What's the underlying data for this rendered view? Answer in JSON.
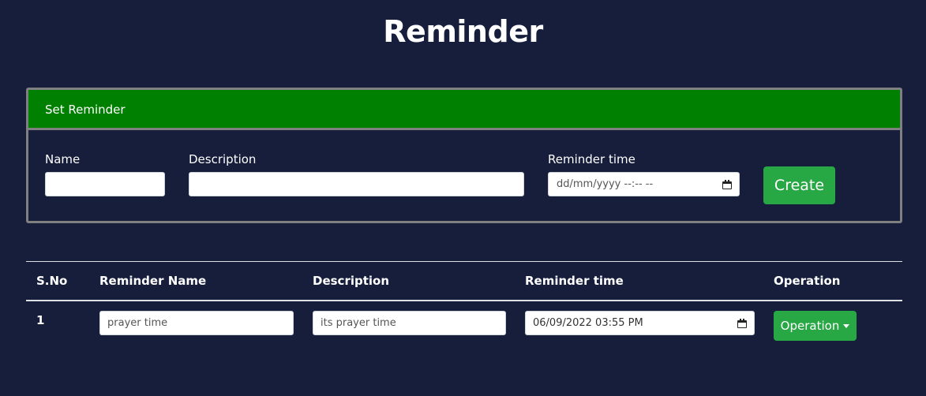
{
  "page": {
    "title": "Reminder"
  },
  "form": {
    "header": "Set Reminder",
    "name_label": "Name",
    "name_value": "",
    "description_label": "Description",
    "description_value": "",
    "time_label": "Reminder time",
    "time_placeholder": "dd/mm/yyyy --:-- --",
    "create_label": "Create"
  },
  "table": {
    "headers": [
      "S.No",
      "Reminder Name",
      "Description",
      "Reminder time",
      "Operation"
    ],
    "rows": [
      {
        "sno": "1",
        "name": "prayer time",
        "description": "its prayer time",
        "time": "06/09/2022 03:55 PM",
        "operation_label": "Operation"
      }
    ]
  },
  "colors": {
    "background": "#161e3c",
    "header_green": "#008000",
    "button_green": "#28a745",
    "card_border": "#808080"
  },
  "icons": [
    "calendar-icon",
    "caret-down-icon"
  ]
}
